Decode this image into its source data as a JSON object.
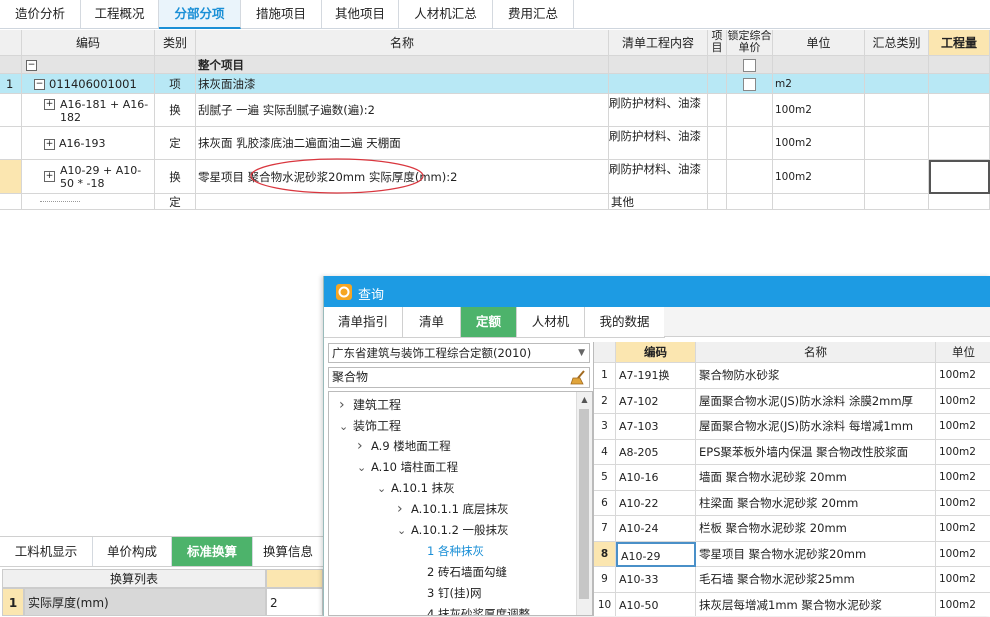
{
  "top_tabs": [
    "造价分析",
    "工程概况",
    "分部分项",
    "措施项目",
    "其他项目",
    "人材机汇总",
    "费用汇总"
  ],
  "grid": {
    "headers": [
      "编码",
      "类别",
      "名称",
      "清单工程内容",
      "项目",
      "锁定综合单价",
      "单位",
      "汇总类别",
      "工程量"
    ],
    "whole_project": "整个项目",
    "rows": [
      {
        "num": "1",
        "code": "011406001001",
        "type": "项",
        "name": "抹灰面油漆",
        "content": "",
        "unit": "m2"
      },
      {
        "num": "",
        "code": "A16-181 + A16-182",
        "type": "换",
        "name": "刮腻子 一遍  实际刮腻子遍数(遍):2",
        "content": "刷防护材料、油漆",
        "unit": "100m2"
      },
      {
        "num": "",
        "code": "A16-193",
        "type": "定",
        "name": "抹灰面 乳胶漆底油二遍面油二遍 天棚面",
        "content": "刷防护材料、油漆",
        "unit": "100m2"
      },
      {
        "num": "",
        "code": "A10-29 + A10-50 * -18",
        "type": "换",
        "name": "零星项目 聚合物水泥砂浆20mm  实际厚度(mm):2",
        "content": "刷防护材料、油漆",
        "unit": "100m2"
      },
      {
        "num": "",
        "code": "",
        "type": "定",
        "name": "",
        "content": "其他",
        "unit": ""
      }
    ]
  },
  "bottom_tabs": [
    "工料机显示",
    "单价构成",
    "标准换算",
    "换算信息"
  ],
  "calc_list": {
    "header": "换算列表",
    "row_num": "1",
    "row_label": "实际厚度(mm)",
    "row_value": "2"
  },
  "dialog": {
    "title": "查询",
    "tabs": [
      "清单指引",
      "清单",
      "定额",
      "人材机",
      "我的数据"
    ],
    "quota_select": "广东省建筑与装饰工程综合定额(2010)",
    "search_value": "聚合物",
    "tree": [
      {
        "label": "建筑工程",
        "indent": 0,
        "arrow": "right"
      },
      {
        "label": "装饰工程",
        "indent": 0,
        "arrow": "down"
      },
      {
        "label": "A.9 楼地面工程",
        "indent": 1,
        "arrow": "right"
      },
      {
        "label": "A.10 墙柱面工程",
        "indent": 1,
        "arrow": "down"
      },
      {
        "label": "A.10.1 抹灰",
        "indent": 2,
        "arrow": "down"
      },
      {
        "label": "A.10.1.1 底层抹灰",
        "indent": 3,
        "arrow": "right"
      },
      {
        "label": "A.10.1.2 一般抹灰",
        "indent": 3,
        "arrow": "down"
      },
      {
        "label": "1 各种抹灰",
        "indent": 4,
        "arrow": "",
        "selected": true
      },
      {
        "label": "2 砖石墙面勾缝",
        "indent": 4,
        "arrow": ""
      },
      {
        "label": "3 钉(挂)网",
        "indent": 4,
        "arrow": ""
      },
      {
        "label": "4 抹灰砂浆厚度调整",
        "indent": 4,
        "arrow": ""
      }
    ],
    "result_headers": [
      "编码",
      "名称",
      "单位"
    ],
    "results": [
      {
        "n": "1",
        "code": "A7-191换",
        "name": "聚合物防水砂浆",
        "unit": "100m2"
      },
      {
        "n": "2",
        "code": "A7-102",
        "name": "屋面聚合物水泥(JS)防水涂料 涂膜2mm厚",
        "unit": "100m2"
      },
      {
        "n": "3",
        "code": "A7-103",
        "name": "屋面聚合物水泥(JS)防水涂料 每增减1mm",
        "unit": "100m2"
      },
      {
        "n": "4",
        "code": "A8-205",
        "name": "EPS聚苯板外墙内保温 聚合物改性胶浆面30mm",
        "unit": "100m2"
      },
      {
        "n": "5",
        "code": "A10-16",
        "name": "墙面 聚合物水泥砂浆 20mm",
        "unit": "100m2"
      },
      {
        "n": "6",
        "code": "A10-22",
        "name": "柱梁面 聚合物水泥砂浆 20mm",
        "unit": "100m2"
      },
      {
        "n": "7",
        "code": "A10-24",
        "name": "栏板 聚合物水泥砂浆 20mm",
        "unit": "100m2"
      },
      {
        "n": "8",
        "code": "A10-29",
        "name": "零星项目 聚合物水泥砂浆20mm",
        "unit": "100m2"
      },
      {
        "n": "9",
        "code": "A10-33",
        "name": "毛石墙 聚合物水泥砂浆25mm",
        "unit": "100m2"
      },
      {
        "n": "10",
        "code": "A10-50",
        "name": "抹灰层每增减1mm 聚合物水泥砂浆",
        "unit": "100m2"
      }
    ]
  }
}
